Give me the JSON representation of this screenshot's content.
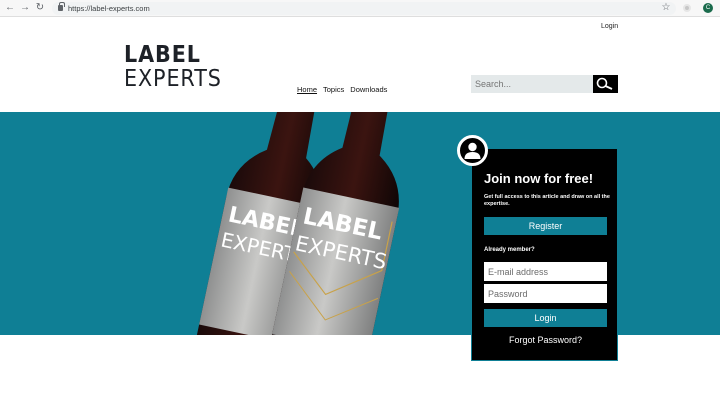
{
  "browser": {
    "url": "https://label-experts.com",
    "profile_initial": "C"
  },
  "header": {
    "login_label": "Login",
    "logo_line1": "LABEL",
    "logo_line2": "EXPERTS",
    "nav": [
      {
        "label": "Home",
        "active": true
      },
      {
        "label": "Topics",
        "active": false
      },
      {
        "label": "Downloads",
        "active": false
      }
    ],
    "search_placeholder": "Search..."
  },
  "hero": {
    "bottle_text_line1": "LABEL",
    "bottle_text_line2": "EXPERTS"
  },
  "card": {
    "title": "Join now for free!",
    "description": "Get full access to this article and draw on all the expertise.",
    "register_label": "Register",
    "already_member": "Already member?",
    "email_placeholder": "E-mail address",
    "password_placeholder": "Password",
    "login_label": "Login",
    "forgot_label": "Forgot Password?"
  },
  "colors": {
    "accent_teal": "#0f7f95",
    "card_bg": "#000000",
    "logo_color": "#1d2127"
  }
}
